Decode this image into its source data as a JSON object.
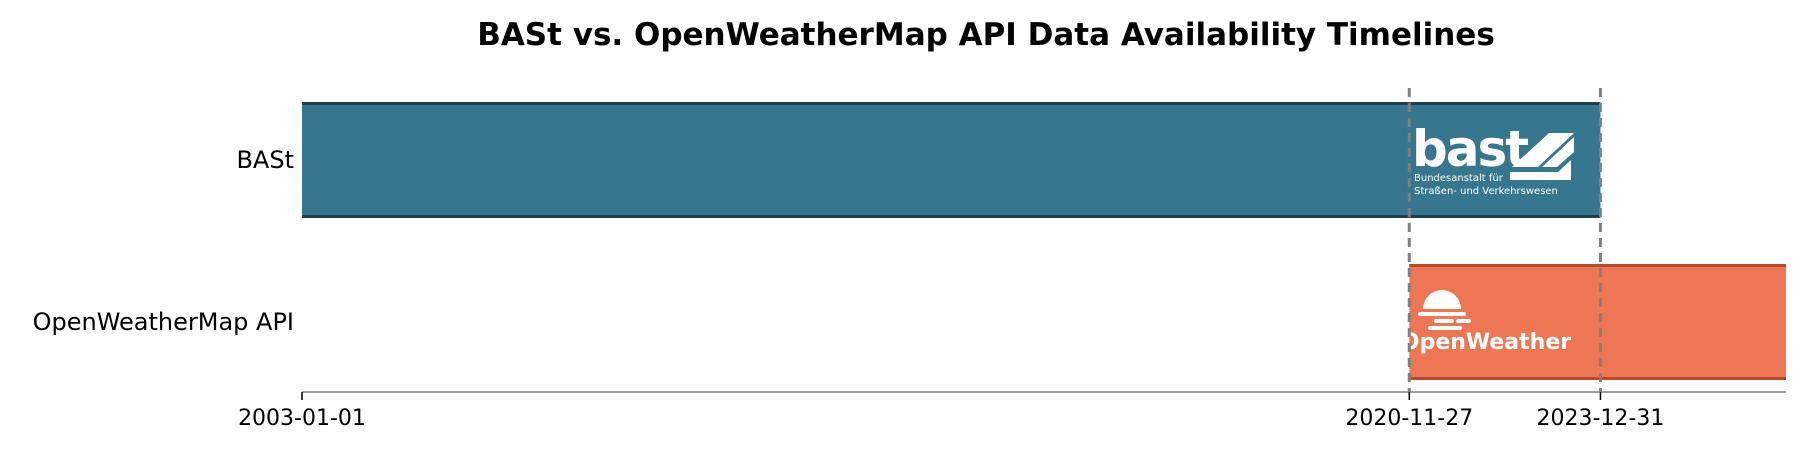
{
  "chart_data": {
    "type": "timeline",
    "title": "BASt vs. OpenWeatherMap API Data Availability Timelines",
    "x_axis": {
      "type": "date",
      "range": [
        "2003-01-01",
        "2026-12-31"
      ],
      "ticks": [
        "2003-01-01",
        "2020-11-27",
        "2023-12-31"
      ]
    },
    "series": [
      {
        "name": "BASt",
        "start": "2003-01-01",
        "end": "2023-12-31",
        "color": "#37768f",
        "edge_color": "#1e3f4e",
        "logo": {
          "name": "bast-logo",
          "wordmark": "bast",
          "line1": "Bundesanstalt für",
          "line2": "Straßen- und Verkehrswesen"
        }
      },
      {
        "name": "OpenWeatherMap API",
        "start": "2020-11-27",
        "end": "2026-12-31",
        "color": "#ed7655",
        "edge_color": "#b84a2c",
        "logo": {
          "name": "openweather-logo",
          "wordmark": "OpenWeather"
        }
      }
    ],
    "reference_lines": [
      "2020-11-27",
      "2023-12-31"
    ],
    "reference_line_color": "#808080",
    "grid": false,
    "legend": "none"
  }
}
